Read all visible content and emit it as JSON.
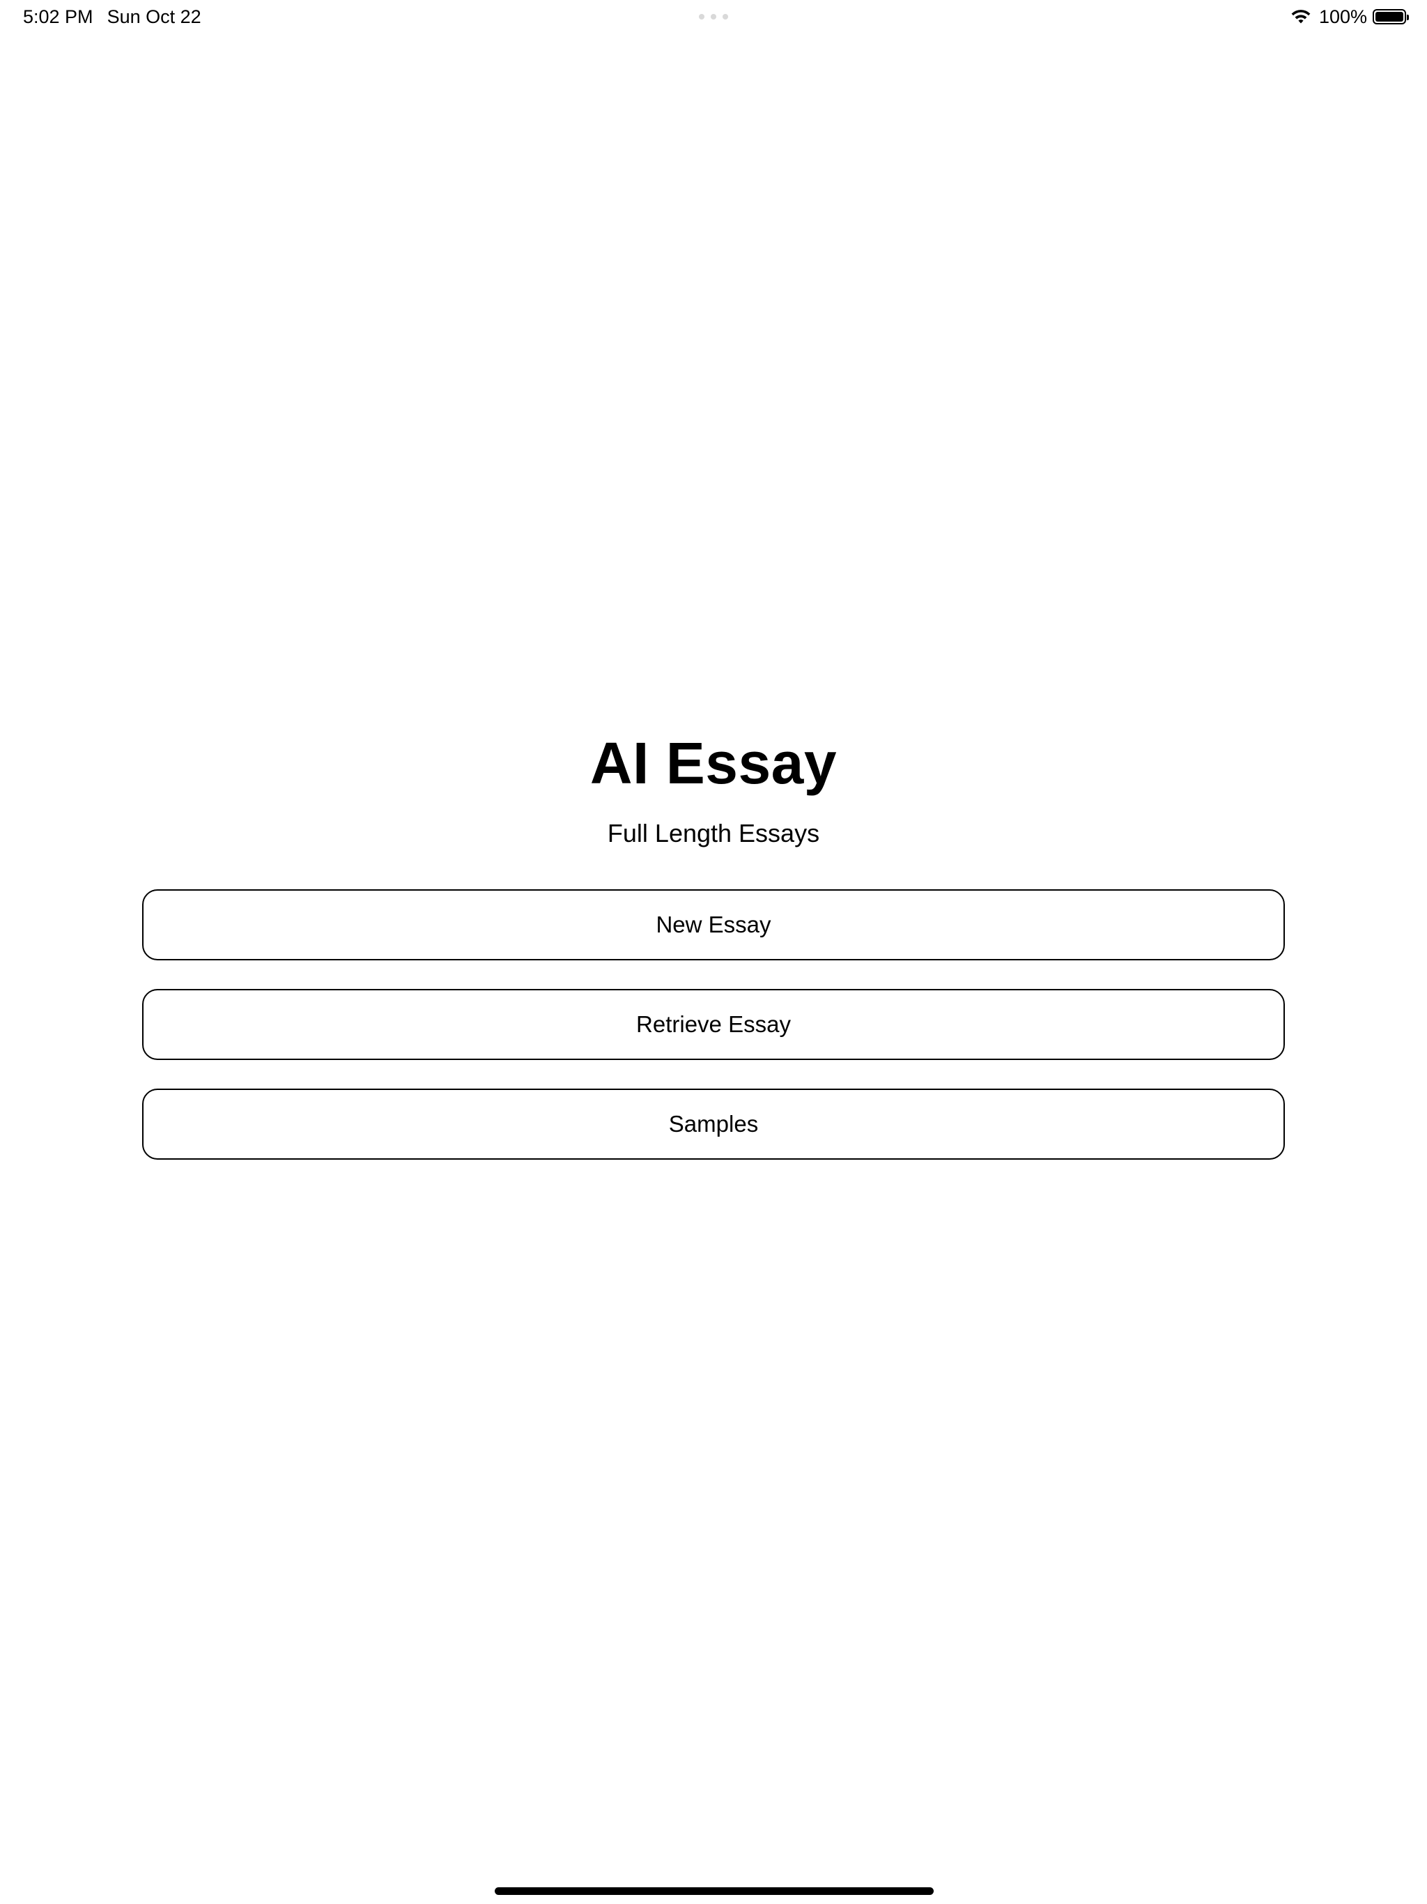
{
  "status_bar": {
    "time": "5:02 PM",
    "date": "Sun Oct 22",
    "battery_percent": "100%",
    "battery_level": 1.0,
    "icons": [
      "wifi-icon",
      "battery-icon"
    ]
  },
  "main": {
    "title": "AI Essay",
    "subtitle": "Full Length Essays",
    "buttons": [
      {
        "label": "New Essay"
      },
      {
        "label": "Retrieve Essay"
      },
      {
        "label": "Samples"
      }
    ]
  },
  "colors": {
    "background": "#ffffff",
    "text": "#000000",
    "button_border": "#000000"
  }
}
